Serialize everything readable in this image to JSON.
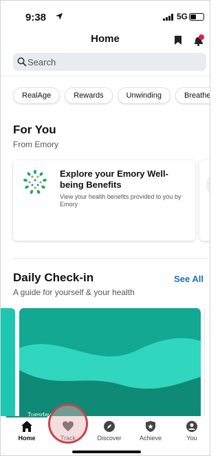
{
  "status_bar": {
    "time": "9:38",
    "network": "5G",
    "battery_level": 0.4
  },
  "header": {
    "title": "Home",
    "bookmark_icon": "bookmark-icon",
    "bell_icon": "bell-icon",
    "notification_dot_color": "#e8194f"
  },
  "search": {
    "placeholder": "Search"
  },
  "chips": [
    "RealAge",
    "Rewards",
    "Unwinding",
    "Breathe and"
  ],
  "for_you": {
    "title": "For You",
    "subtitle": "From Emory",
    "card": {
      "title": "Explore your Emory Well-being Benefits",
      "description": "View your health benefits provided to you by Emory"
    }
  },
  "daily_checkin": {
    "title": "Daily Check-in",
    "subtitle": "A guide for yourself & your health",
    "see_all": "See All",
    "card_date": "Tuesday"
  },
  "tabs": [
    {
      "label": "Home",
      "icon": "home-icon",
      "active": true
    },
    {
      "label": "Track",
      "icon": "heart-icon",
      "active": false
    },
    {
      "label": "Discover",
      "icon": "compass-icon",
      "active": false
    },
    {
      "label": "Achieve",
      "icon": "shield-star-icon",
      "active": false
    },
    {
      "label": "You",
      "icon": "person-icon",
      "active": false
    }
  ],
  "colors": {
    "accent": "#1f6fb5",
    "teal": "#1ec7b0",
    "teal_dark": "#12a58f",
    "highlight": "#c9434a"
  }
}
